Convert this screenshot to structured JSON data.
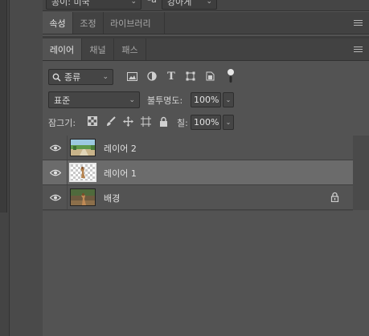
{
  "top": {
    "dropdown1": "공이: 미국",
    "icon_label": "ªa",
    "dropdown2": "강아게"
  },
  "tabs_top": [
    {
      "label": "속성",
      "active": true
    },
    {
      "label": "조정",
      "active": false
    },
    {
      "label": "라이브러리",
      "active": false
    }
  ],
  "tabs_layers": [
    {
      "label": "레이어",
      "active": true
    },
    {
      "label": "채널",
      "active": false
    },
    {
      "label": "패스",
      "active": false
    }
  ],
  "filter": {
    "kind_label": "종류",
    "icons": [
      "image-filter-icon",
      "adjustment-filter-icon",
      "type-filter-icon",
      "shape-filter-icon",
      "smart-object-filter-icon",
      "filter-toggle-icon"
    ]
  },
  "blend": {
    "mode": "표준",
    "opacity_label": "불투명도:",
    "opacity_value": "100%"
  },
  "lock": {
    "label": "잠그기:",
    "fill_label": "칠:",
    "fill_value": "100%",
    "icons": [
      "lock-transparent-icon",
      "lock-image-icon",
      "lock-position-icon",
      "lock-artboard-icon",
      "lock-all-icon"
    ]
  },
  "layers": [
    {
      "name": "레이어 2",
      "selected": false,
      "locked": false,
      "thumb": "landscape"
    },
    {
      "name": "레이어 1",
      "selected": true,
      "locked": false,
      "thumb": "cutout"
    },
    {
      "name": "배경",
      "selected": false,
      "locked": true,
      "thumb": "photo"
    }
  ],
  "colors": {
    "panel_bg": "#535353",
    "selected_row": "#6b6b6b",
    "tab_bar": "#424242"
  }
}
